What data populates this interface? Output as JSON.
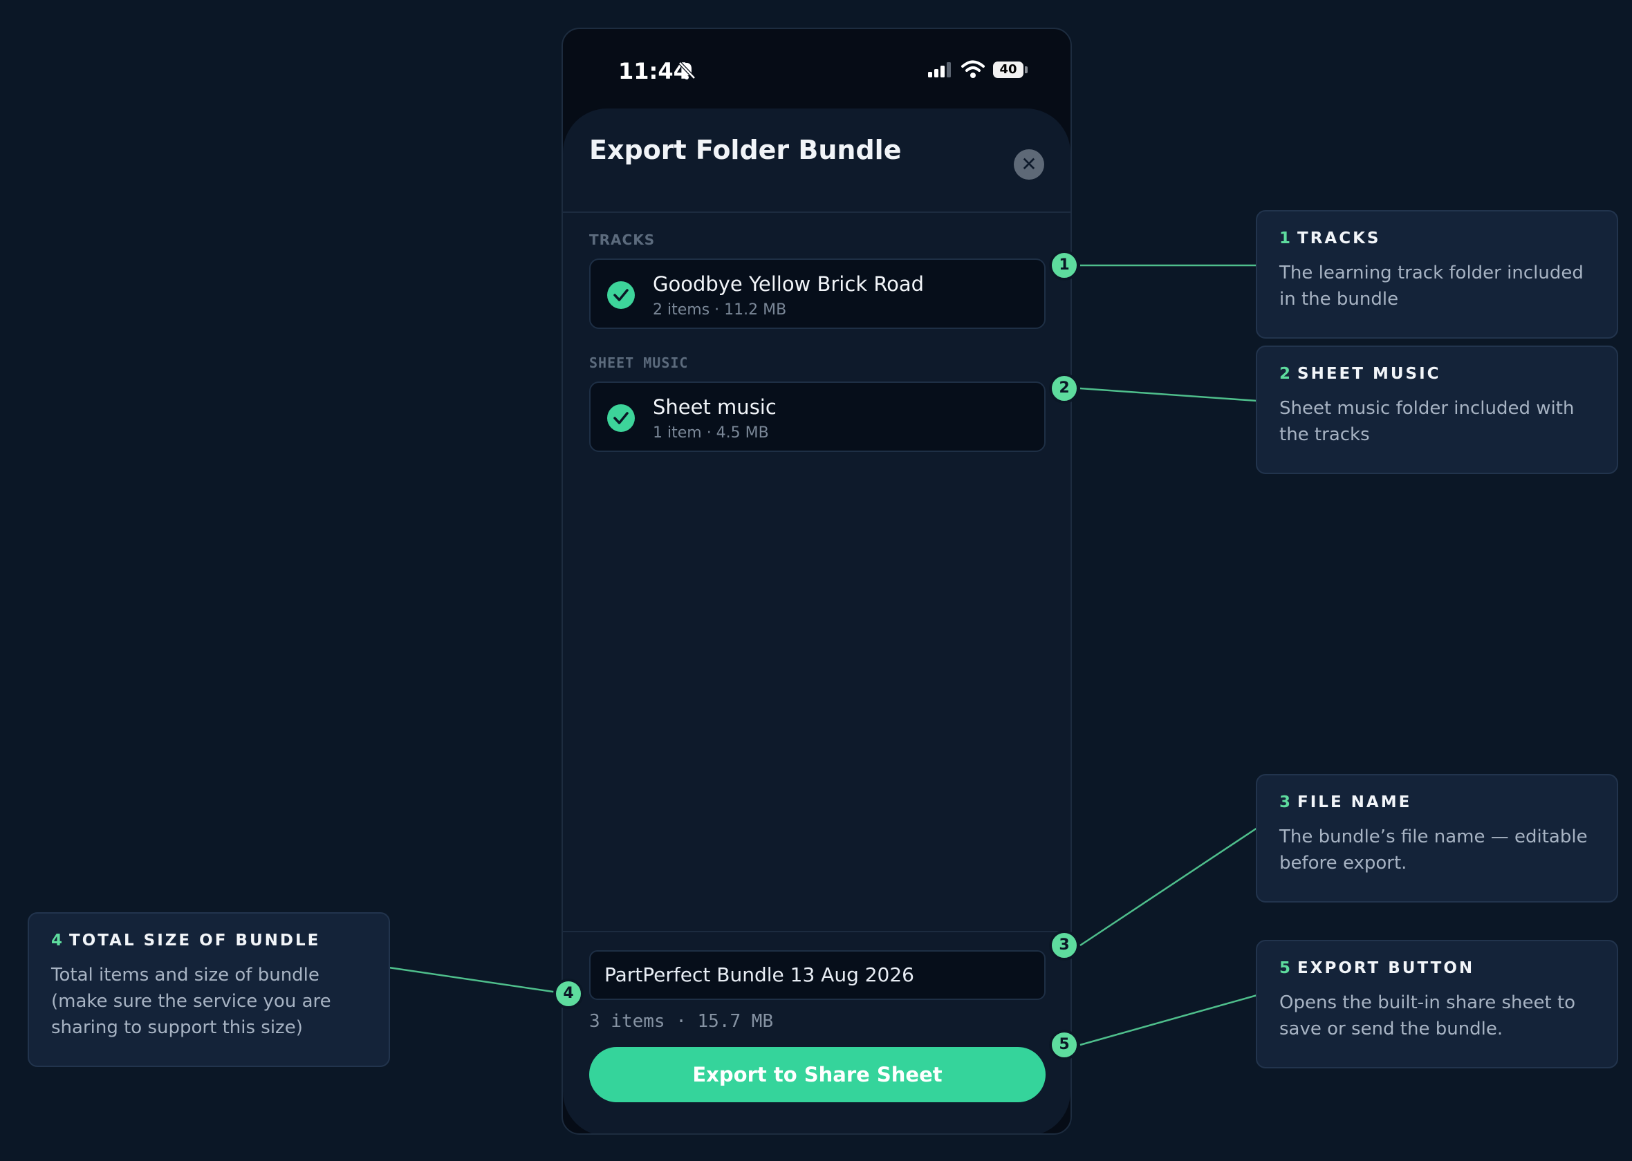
{
  "status_bar": {
    "time": "11:44",
    "battery": "40"
  },
  "sheet": {
    "title": "Export Folder Bundle",
    "close_icon": "close-icon",
    "sections": [
      {
        "label": "TRACKS",
        "folder": {
          "name": "Goodbye Yellow Brick Road",
          "meta": "2 items · 11.2 MB",
          "checked": true
        }
      },
      {
        "label": "SHEET MUSIC",
        "folder": {
          "name": "Sheet music",
          "meta": "1 item · 4.5 MB",
          "checked": true
        }
      }
    ],
    "file_name": "PartPerfect Bundle 13 Aug 2026",
    "total": "3 items · 15.7 MB",
    "export_label": "Export to Share Sheet"
  },
  "markers": [
    "1",
    "2",
    "3",
    "4",
    "5"
  ],
  "callouts": [
    {
      "num": "1",
      "title": "TRACKS",
      "body": "The learning track folder included in the bundle"
    },
    {
      "num": "2",
      "title": "SHEET MUSIC",
      "body": "Sheet music folder included with the tracks"
    },
    {
      "num": "3",
      "title": "FILE NAME",
      "body": "The bundle’s file name — editable before export."
    },
    {
      "num": "4",
      "title": "TOTAL SIZE OF BUNDLE",
      "body": "Total items and size of bundle (make sure the service you are sharing to support this size)"
    },
    {
      "num": "5",
      "title": "EXPORT BUTTON",
      "body": "Opens the built-in share sheet to save or send the bundle."
    }
  ],
  "colors": {
    "accent": "#35d49b",
    "background": "#0b1726",
    "sheet": "#0e1a2b",
    "callout": "#142339"
  }
}
